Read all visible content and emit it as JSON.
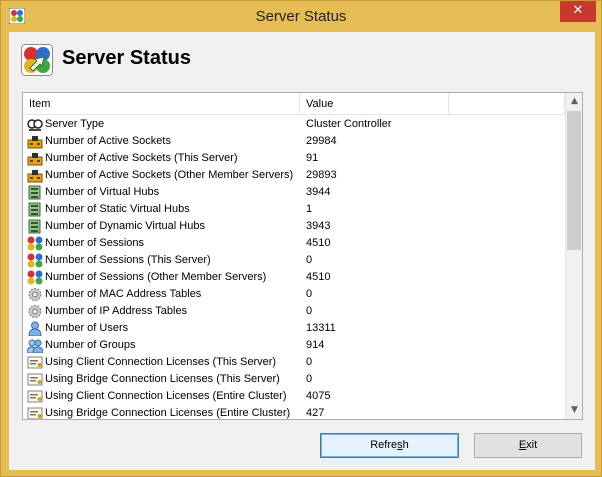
{
  "window": {
    "title": "Server Status"
  },
  "header": {
    "title": "Server Status"
  },
  "list": {
    "columns": [
      "Item",
      "Value",
      ""
    ],
    "rows": [
      {
        "icon": "server-type-icon",
        "item": "Server Type",
        "value": "Cluster Controller"
      },
      {
        "icon": "socket-icon",
        "item": "Number of Active Sockets",
        "value": "29984"
      },
      {
        "icon": "socket-icon",
        "item": "Number of Active Sockets (This Server)",
        "value": "91"
      },
      {
        "icon": "socket-icon",
        "item": "Number of Active Sockets (Other Member Servers)",
        "value": "29893"
      },
      {
        "icon": "virtual-hub-icon",
        "item": "Number of Virtual Hubs",
        "value": "3944"
      },
      {
        "icon": "virtual-hub-icon",
        "item": "Number of Static Virtual Hubs",
        "value": "1"
      },
      {
        "icon": "virtual-hub-icon",
        "item": "Number of Dynamic Virtual Hubs",
        "value": "3943"
      },
      {
        "icon": "sessions-icon",
        "item": "Number of Sessions",
        "value": "4510"
      },
      {
        "icon": "sessions-icon",
        "item": "Number of Sessions (This Server)",
        "value": "0"
      },
      {
        "icon": "sessions-icon",
        "item": "Number of Sessions (Other Member Servers)",
        "value": "4510"
      },
      {
        "icon": "gear-icon",
        "item": "Number of MAC Address Tables",
        "value": "0"
      },
      {
        "icon": "gear-icon",
        "item": "Number of IP Address Tables",
        "value": "0"
      },
      {
        "icon": "user-icon",
        "item": "Number of Users",
        "value": "13311"
      },
      {
        "icon": "group-icon",
        "item": "Number of Groups",
        "value": "914"
      },
      {
        "icon": "license-icon",
        "item": "Using Client Connection Licenses (This Server)",
        "value": "0"
      },
      {
        "icon": "license-icon",
        "item": "Using Bridge Connection Licenses (This Server)",
        "value": "0"
      },
      {
        "icon": "license-icon",
        "item": "Using Client Connection Licenses (Entire Cluster)",
        "value": "4075"
      },
      {
        "icon": "license-icon",
        "item": "Using Bridge Connection Licenses (Entire Cluster)",
        "value": "427"
      }
    ]
  },
  "buttons": {
    "refresh_before": "Refre",
    "refresh_mnemonic": "s",
    "refresh_after": "h",
    "exit_mnemonic": "E",
    "exit_after": "xit"
  },
  "colors": {
    "frame": "#e6bc55",
    "close": "#c7392c",
    "client_bg": "#f0f0f0",
    "default_button_border": "#3c7fb1"
  }
}
